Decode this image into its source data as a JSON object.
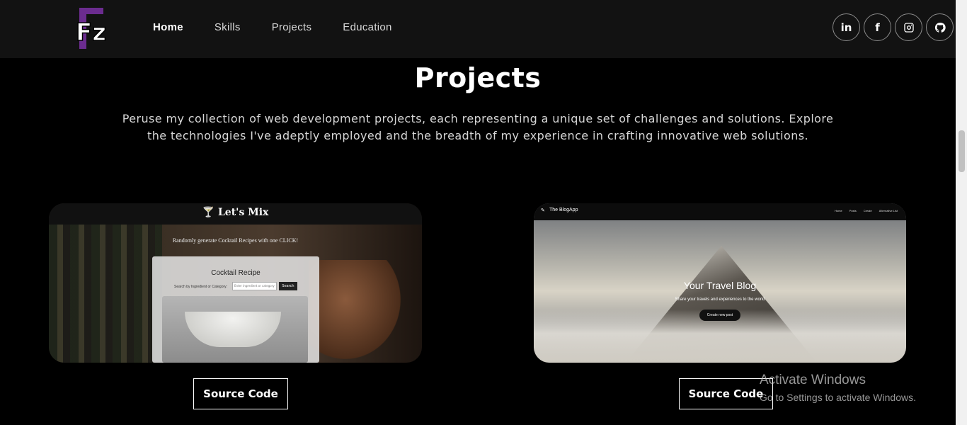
{
  "navbar": {
    "logo_text": "Fz",
    "links": [
      {
        "label": "Home",
        "active": true
      },
      {
        "label": "Skills",
        "active": false
      },
      {
        "label": "Projects",
        "active": false
      },
      {
        "label": "Education",
        "active": false
      }
    ],
    "social": [
      {
        "icon": "linkedin-icon",
        "label": "in"
      },
      {
        "icon": "facebook-icon",
        "label": "f"
      },
      {
        "icon": "instagram-icon"
      },
      {
        "icon": "github-icon"
      }
    ]
  },
  "projects_section": {
    "title": "Projects",
    "description": "Peruse my collection of web development projects, each representing a unique set of challenges and solutions. Explore the technologies I've adeptly employed and the breadth of my experience in crafting innovative web solutions."
  },
  "projects": [
    {
      "preview": {
        "brand": "Let's Mix",
        "tagline": "Randomly generate Cocktail Recipes with one CLICK!",
        "panel_title": "Cocktail Recipe",
        "search_label": "Search by Ingredient or Category:",
        "search_placeholder": "Enter ingredient or category",
        "search_button": "Search"
      },
      "button_label": "Source Code"
    },
    {
      "preview": {
        "brand": "The BlogApp",
        "nav": [
          "Home",
          "Posts",
          "Create",
          "Alternative List"
        ],
        "hero_title": "Your Travel Blog",
        "hero_subtitle": "Share your travels and experiences to the world",
        "cta": "Create new post"
      },
      "button_label": "Source Code"
    }
  ],
  "watermark": {
    "title": "Activate Windows",
    "subtitle": "Go to Settings to activate Windows."
  },
  "colors": {
    "background": "#000000",
    "navbar": "#121212",
    "logo_accent": "#6b2c8f"
  }
}
